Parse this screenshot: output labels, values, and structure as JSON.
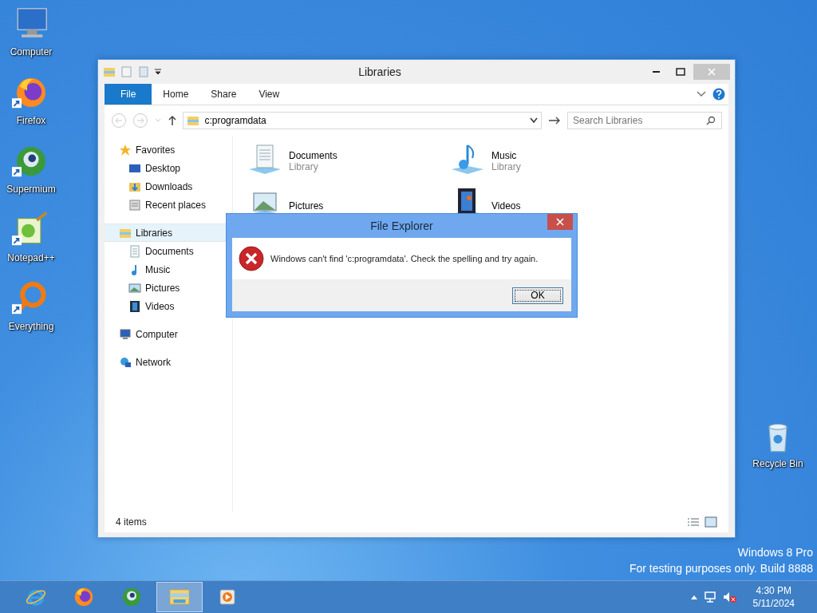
{
  "desktop_icons": [
    {
      "label": "Computer",
      "kind": "computer",
      "shortcut": false
    },
    {
      "label": "Firefox",
      "kind": "firefox",
      "shortcut": true
    },
    {
      "label": "Supermium",
      "kind": "supermium",
      "shortcut": true
    },
    {
      "label": "Notepad++",
      "kind": "notepad",
      "shortcut": true
    },
    {
      "label": "Everything",
      "kind": "everything",
      "shortcut": true
    }
  ],
  "recycle_bin": {
    "label": "Recycle Bin"
  },
  "explorer": {
    "title": "Libraries",
    "file_tab": "File",
    "ribbon_tabs": [
      "Home",
      "Share",
      "View"
    ],
    "address": "c:programdata",
    "search": {
      "placeholder": "Search Libraries"
    },
    "nav": [
      {
        "label": "Favorites",
        "kind": "star",
        "selected": false,
        "children": [
          {
            "label": "Desktop",
            "kind": "desktop"
          },
          {
            "label": "Downloads",
            "kind": "downloads"
          },
          {
            "label": "Recent places",
            "kind": "recent"
          }
        ]
      },
      {
        "label": "Libraries",
        "kind": "libraries",
        "selected": true,
        "children": [
          {
            "label": "Documents",
            "kind": "documents"
          },
          {
            "label": "Music",
            "kind": "music"
          },
          {
            "label": "Pictures",
            "kind": "pictures"
          },
          {
            "label": "Videos",
            "kind": "videos"
          }
        ]
      },
      {
        "label": "Computer",
        "kind": "computer",
        "selected": false
      },
      {
        "label": "Network",
        "kind": "network",
        "selected": false
      }
    ],
    "items": [
      {
        "name": "Documents",
        "subtitle": "Library",
        "kind": "documents"
      },
      {
        "name": "Music",
        "subtitle": "Library",
        "kind": "music"
      },
      {
        "name": "Pictures",
        "kind": "pictures"
      },
      {
        "name": "Videos",
        "kind": "videos"
      }
    ],
    "status_bar": "4 items"
  },
  "dialog": {
    "title": "File Explorer",
    "message": "Windows can't find 'c:programdata'. Check the spelling and try again.",
    "button": "OK"
  },
  "edition": [
    "Windows 8 Pro",
    "For testing purposes only. Build 8888"
  ],
  "taskbar": {
    "apps": [
      {
        "kind": "ie",
        "selected": false
      },
      {
        "kind": "firefox",
        "selected": false
      },
      {
        "kind": "supermium",
        "selected": false
      },
      {
        "kind": "explorer",
        "selected": true
      },
      {
        "kind": "media",
        "selected": false
      }
    ],
    "time": "4:30 PM",
    "date": "5/11/2024"
  }
}
